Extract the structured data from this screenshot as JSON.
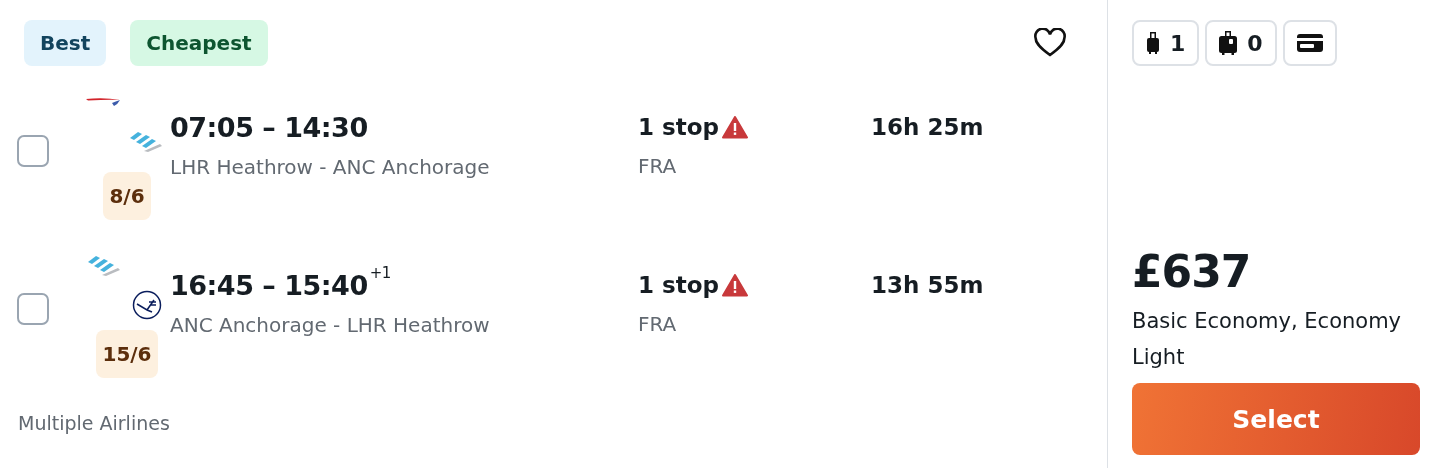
{
  "tags": [
    {
      "label": "Best",
      "kind": "best"
    },
    {
      "label": "Cheapest",
      "kind": "cheapest"
    }
  ],
  "favorite": {
    "saved": false
  },
  "legs": [
    {
      "checked": false,
      "logos": [
        {
          "kind": "ribbon"
        },
        {
          "kind": "wings"
        }
      ],
      "date": "8/6",
      "times": "07:05 – 14:30",
      "route": "LHR Heathrow - ANC Anchorage",
      "stops": "1 stop",
      "warning": true,
      "via": "FRA",
      "duration": "16h 25m"
    },
    {
      "checked": false,
      "logos": [
        {
          "kind": "wings"
        },
        {
          "kind": "crane"
        }
      ],
      "date": "15/6",
      "times": "16:45 – 15:40",
      "day_offset": "+1",
      "route": "ANC Anchorage - LHR Heathrow",
      "stops": "1 stop",
      "warning": true,
      "via": "FRA",
      "duration": "13h 55m"
    }
  ],
  "airlines": "Multiple Airlines",
  "bags": [
    {
      "kind": "cabin",
      "count": "1"
    },
    {
      "kind": "checked",
      "count": "0"
    },
    {
      "kind": "card"
    }
  ],
  "price": "£637",
  "fare": "Basic Economy, Economy Light",
  "select_button": "Select"
}
